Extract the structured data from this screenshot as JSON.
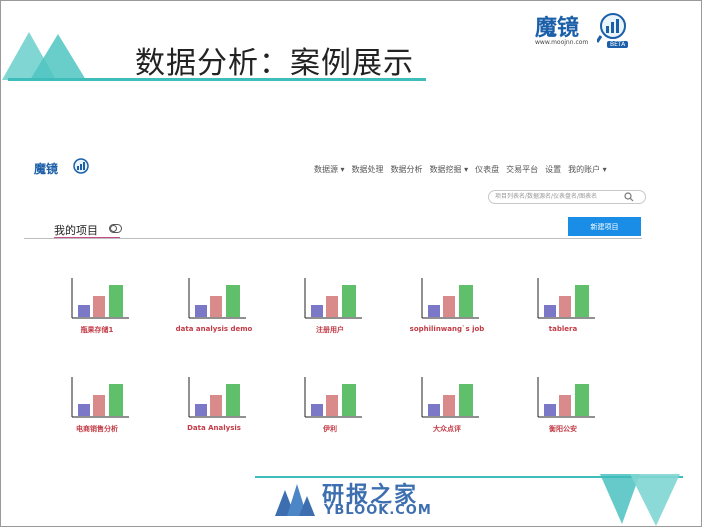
{
  "slide": {
    "title": "数据分析：案例展示",
    "brand_name": "魔镜",
    "brand_url": "www.moojnn.com",
    "brand_beta": "BETA",
    "accent": "#3fbdbb"
  },
  "app": {
    "logo_name": "魔镜",
    "nav": [
      "数据源 ▾",
      "数据处理",
      "数据分析",
      "数据挖掘 ▾",
      "仪表盘",
      "交易平台",
      "设置",
      "我的账户 ▾"
    ],
    "search_placeholder": "项目列表名/数据源名/仪表盘名/图表名",
    "section_title": "我的项目",
    "new_project_button": "新建项目",
    "projects": [
      {
        "name": "瓶果存储1"
      },
      {
        "name": "data analysis demo"
      },
      {
        "name": "注册用户"
      },
      {
        "name": "sophilinwang`s job"
      },
      {
        "name": "tablera"
      },
      {
        "name": "电商销售分析"
      },
      {
        "name": "Data Analysis"
      },
      {
        "name": "伊利"
      },
      {
        "name": "大众点评"
      },
      {
        "name": "衡阳公安"
      }
    ],
    "icon_colors": {
      "bar1": "#7b78c8",
      "bar2": "#d98a8a",
      "bar3": "#5fbf6a"
    }
  },
  "watermark": {
    "cn": "研报之家",
    "en": "YBLOOK.COM"
  }
}
